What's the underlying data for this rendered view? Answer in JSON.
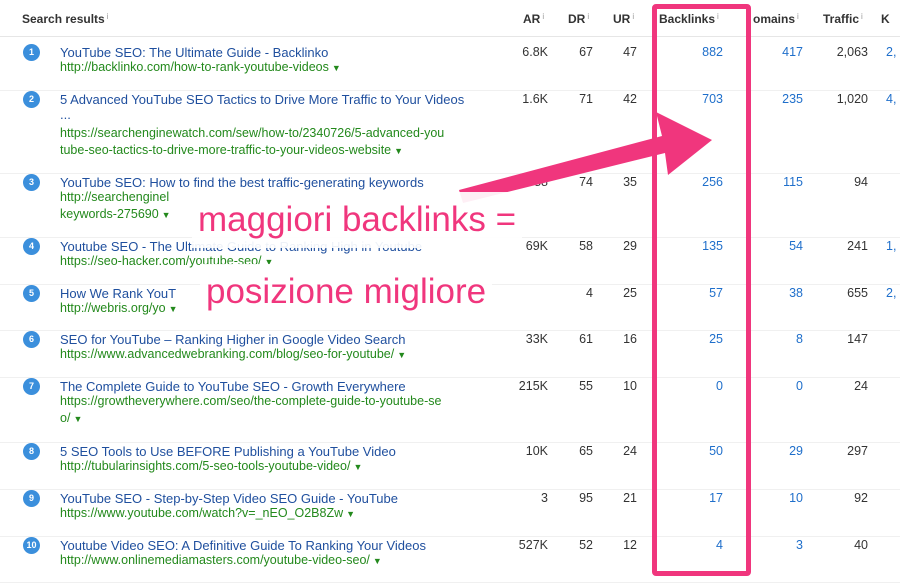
{
  "header": {
    "search_results": "Search results",
    "ar": "AR",
    "dr": "DR",
    "ur": "UR",
    "backlinks": "Backlinks",
    "domains": "omains",
    "traffic": "Traffic",
    "k": "K",
    "info_glyph": "i"
  },
  "rows": [
    {
      "n": "1",
      "title": "YouTube SEO: The Ultimate Guide - Backlinko",
      "url": "http://backlinko.com/how-to-rank-youtube-videos",
      "ar": "6.8K",
      "dr": "67",
      "ur": "47",
      "backlinks": "882",
      "domains": "417",
      "traffic": "2,063",
      "k": "2,"
    },
    {
      "n": "2",
      "title": "5 Advanced YouTube SEO Tactics to Drive More Traffic to Your Videos",
      "title2": "...",
      "url": "https://searchenginewatch.com/sew/how-to/2340726/5-advanced-you\ntube-seo-tactics-to-drive-more-traffic-to-your-videos-website",
      "ar": "1.6K",
      "dr": "71",
      "ur": "42",
      "backlinks": "703",
      "domains": "235",
      "traffic": "1,020",
      "k": "4,"
    },
    {
      "n": "3",
      "title": "YouTube SEO: How to find the best traffic-generating keywords",
      "url": "http://searchenginel\nkeywords-275690",
      "ar": "788",
      "dr": "74",
      "ur": "35",
      "backlinks": "256",
      "domains": "115",
      "traffic": "94",
      "k": ""
    },
    {
      "n": "4",
      "title": "Youtube SEO - The Ultimate Guide to Ranking High in Youtube",
      "url": "https://seo-hacker.com/youtube-seo/",
      "ar": "69K",
      "dr": "58",
      "ur": "29",
      "backlinks": "135",
      "domains": "54",
      "traffic": "241",
      "k": "1,"
    },
    {
      "n": "5",
      "title": "How We Rank YouT",
      "url": "http://webris.org/yo",
      "ar": "",
      "dr": "4",
      "ur": "25",
      "backlinks": "57",
      "domains": "38",
      "traffic": "655",
      "k": "2,"
    },
    {
      "n": "6",
      "title": "SEO for YouTube – Ranking Higher in Google Video Search",
      "url": "https://www.advancedwebranking.com/blog/seo-for-youtube/",
      "ar": "33K",
      "dr": "61",
      "ur": "16",
      "backlinks": "25",
      "domains": "8",
      "traffic": "147",
      "k": ""
    },
    {
      "n": "7",
      "title": "The Complete Guide to YouTube SEO - Growth Everywhere",
      "url": "https://growtheverywhere.com/seo/the-complete-guide-to-youtube-se\no/",
      "ar": "215K",
      "dr": "55",
      "ur": "10",
      "backlinks": "0",
      "domains": "0",
      "traffic": "24",
      "k": ""
    },
    {
      "n": "8",
      "title": "5 SEO Tools to Use BEFORE Publishing a YouTube Video",
      "url": "http://tubularinsights.com/5-seo-tools-youtube-video/",
      "ar": "10K",
      "dr": "65",
      "ur": "24",
      "backlinks": "50",
      "domains": "29",
      "traffic": "297",
      "k": ""
    },
    {
      "n": "9",
      "title": "YouTube SEO - Step-by-Step Video SEO Guide - YouTube",
      "url": "https://www.youtube.com/watch?v=_nEO_O2B8Zw",
      "ar": "3",
      "dr": "95",
      "ur": "21",
      "backlinks": "17",
      "domains": "10",
      "traffic": "92",
      "k": ""
    },
    {
      "n": "10",
      "title": "Youtube Video SEO: A Definitive Guide To Ranking Your Videos",
      "url": "http://www.onlinemediamasters.com/youtube-video-seo/",
      "ar": "527K",
      "dr": "52",
      "ur": "12",
      "backlinks": "4",
      "domains": "3",
      "traffic": "40",
      "k": ""
    }
  ],
  "annotation": {
    "line1": "maggiori backlinks =",
    "line2": "posizione migliore",
    "color": "#f0367d"
  },
  "caret_glyph": "▼"
}
